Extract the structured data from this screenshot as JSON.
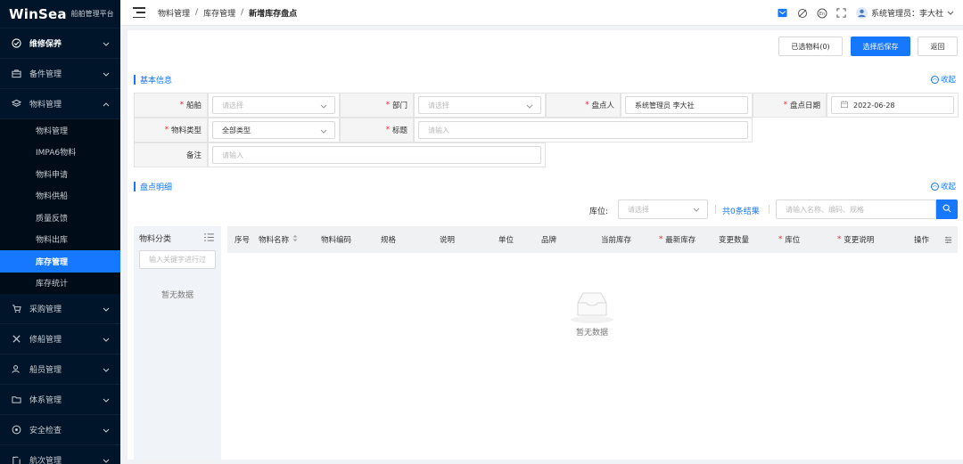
{
  "app": {
    "brand": "WinSea",
    "subtitle": "船舶管理平台"
  },
  "sidebar": {
    "items": [
      {
        "label": "维修保养",
        "icon": "check-circle-icon",
        "expanded": false,
        "active": true
      },
      {
        "label": "备件管理",
        "icon": "briefcase-icon",
        "expanded": false
      },
      {
        "label": "物料管理",
        "icon": "layers-icon",
        "expanded": true
      },
      {
        "label": "采购管理",
        "icon": "cart-icon",
        "expanded": false
      },
      {
        "label": "修船管理",
        "icon": "tools-icon",
        "expanded": false
      },
      {
        "label": "船员管理",
        "icon": "users-icon",
        "expanded": false
      },
      {
        "label": "体系管理",
        "icon": "folder-icon",
        "expanded": false
      },
      {
        "label": "安全检查",
        "icon": "shield-icon",
        "expanded": false
      },
      {
        "label": "航次管理",
        "icon": "route-icon",
        "expanded": false
      }
    ],
    "material_subitems": [
      {
        "label": "物料管理"
      },
      {
        "label": "IMPA6物料"
      },
      {
        "label": "物料申请"
      },
      {
        "label": "物料供船"
      },
      {
        "label": "质量反馈"
      },
      {
        "label": "物料出库"
      },
      {
        "label": "库存管理",
        "selected": true
      },
      {
        "label": "库存统计"
      }
    ]
  },
  "header": {
    "breadcrumb": [
      "物料管理",
      "库存管理",
      "新增库存盘点"
    ],
    "separator": "/",
    "user_label": "系统管理员：李大社",
    "icons": [
      "mail-icon",
      "eye-off-icon",
      "language-icon",
      "fullscreen-icon",
      "user-avatar-icon",
      "chevron-down-icon"
    ]
  },
  "toolbar": {
    "selected_btn": "已选物料(0)",
    "save_btn": "选择后保存",
    "back_btn": "返回"
  },
  "basic_info": {
    "title": "基本信息",
    "collapse": "收起",
    "fields": {
      "ship": {
        "label": "船舶",
        "required": true,
        "placeholder": "请选择",
        "value": ""
      },
      "dept": {
        "label": "部门",
        "required": true,
        "placeholder": "请选择",
        "value": ""
      },
      "counter": {
        "label": "盘点人",
        "required": true,
        "value": "系统管理员 李大社"
      },
      "date": {
        "label": "盘点日期",
        "required": true,
        "value": "2022-06-28"
      },
      "type": {
        "label": "物料类型",
        "required": true,
        "value": "全部类型"
      },
      "title": {
        "label": "标题",
        "required": true,
        "placeholder": "请输入",
        "value": ""
      },
      "remark": {
        "label": "备注",
        "required": false,
        "placeholder": "请输入",
        "value": ""
      }
    }
  },
  "detail": {
    "title": "盘点明细",
    "collapse": "收起",
    "location_label": "库位:",
    "location_placeholder": "请选择",
    "result_text": "共0条结果",
    "search_placeholder": "请输入名称、编码、规格",
    "category": {
      "title": "物料分类",
      "filter_placeholder": "输入关键字进行过",
      "empty": "暂无数据"
    },
    "columns": [
      {
        "label": "序号"
      },
      {
        "label": "物料名称",
        "sortable": true
      },
      {
        "label": "物料编码"
      },
      {
        "label": "规格"
      },
      {
        "label": "说明"
      },
      {
        "label": "单位"
      },
      {
        "label": "品牌"
      },
      {
        "label": "当前库存"
      },
      {
        "label": "最新库存",
        "required": true
      },
      {
        "label": "变更数量"
      },
      {
        "label": "库位",
        "required": true
      },
      {
        "label": "变更说明",
        "required": true
      },
      {
        "label": "操作"
      }
    ],
    "empty_text": "暂无数据"
  },
  "colors": {
    "sidebar_bg": "#001529",
    "accent": "#1677ff",
    "required": "#f5222d"
  }
}
